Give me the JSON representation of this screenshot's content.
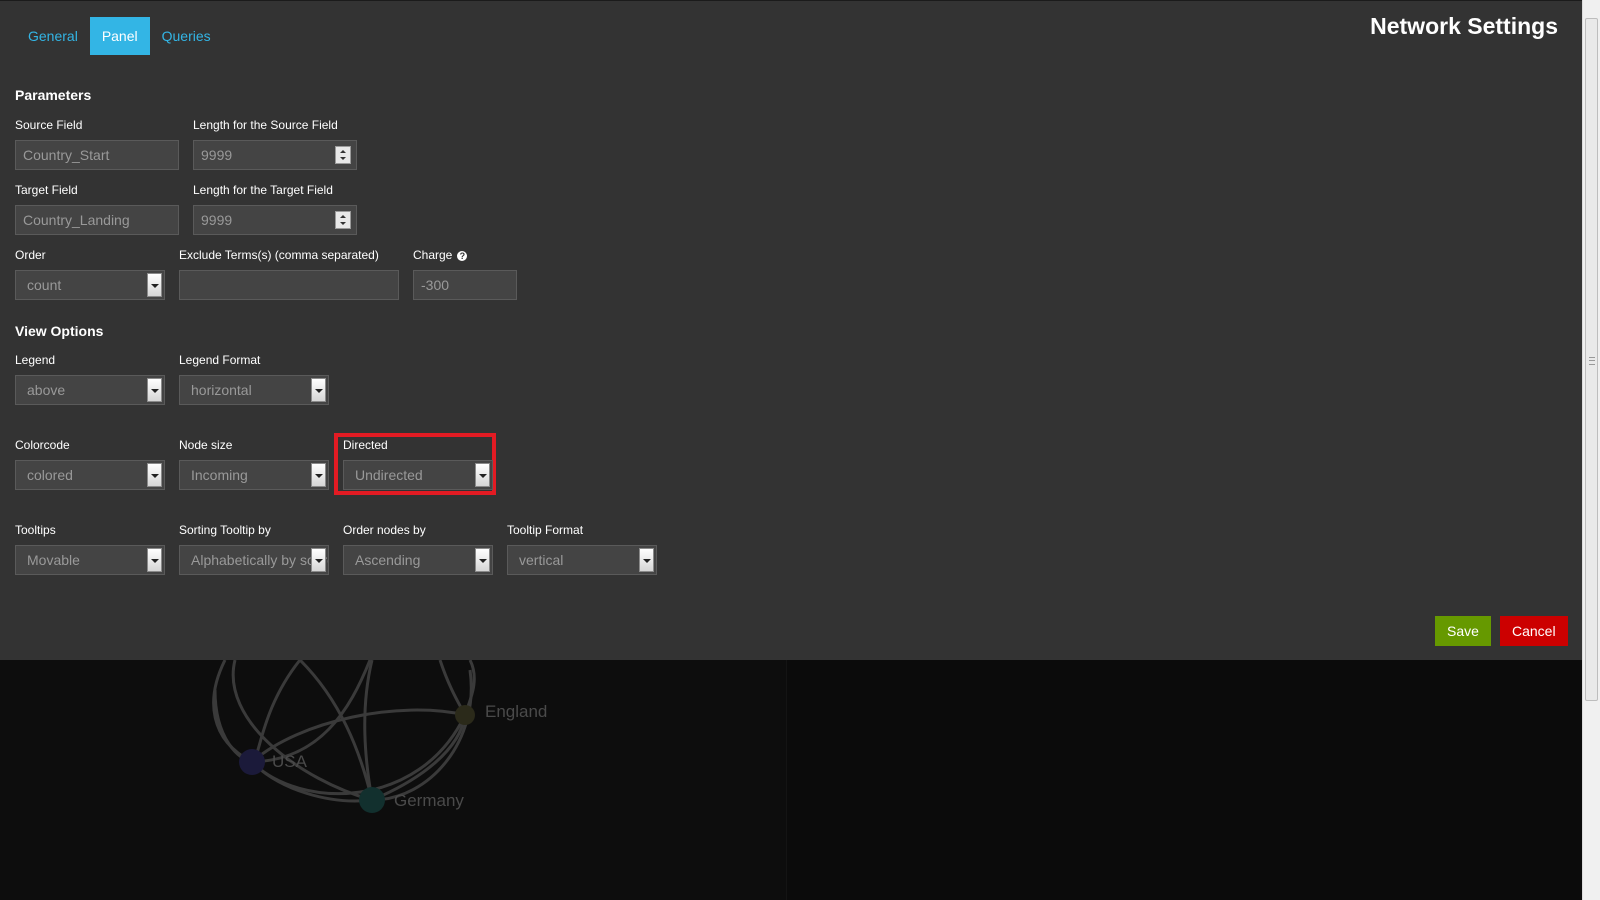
{
  "tabs": [
    {
      "label": "General",
      "active": false
    },
    {
      "label": "Panel",
      "active": true
    },
    {
      "label": "Queries",
      "active": false
    }
  ],
  "title": "Network Settings",
  "parameters": {
    "heading": "Parameters",
    "source_field": {
      "label": "Source Field",
      "value": "Country_Start"
    },
    "source_length": {
      "label": "Length for the Source Field",
      "value": "9999"
    },
    "target_field": {
      "label": "Target Field",
      "value": "Country_Landing"
    },
    "target_length": {
      "label": "Length for the Target Field",
      "value": "9999"
    },
    "order": {
      "label": "Order",
      "value": "count"
    },
    "exclude": {
      "label": "Exclude Terms(s) (comma separated)",
      "value": ""
    },
    "charge": {
      "label": "Charge",
      "value": "-300",
      "help_icon": "question-circle-icon"
    }
  },
  "view_options": {
    "heading": "View Options",
    "legend": {
      "label": "Legend",
      "value": "above"
    },
    "legend_format": {
      "label": "Legend Format",
      "value": "horizontal"
    },
    "colorcode": {
      "label": "Colorcode",
      "value": "colored"
    },
    "node_size": {
      "label": "Node size",
      "value": "Incoming"
    },
    "directed": {
      "label": "Directed",
      "value": "Undirected"
    },
    "tooltips": {
      "label": "Tooltips",
      "value": "Movable"
    },
    "sorting_tooltip": {
      "label": "Sorting Tooltip by",
      "value": "Alphabetically by source"
    },
    "order_nodes": {
      "label": "Order nodes by",
      "value": "Ascending"
    },
    "tooltip_format": {
      "label": "Tooltip Format",
      "value": "vertical"
    }
  },
  "buttons": {
    "save": "Save",
    "cancel": "Cancel"
  },
  "graph_labels": {
    "england": "England",
    "usa": "USA",
    "germany": "Germany"
  },
  "colors": {
    "accent": "#33b5e5",
    "save": "#669900",
    "cancel": "#cc0000",
    "highlight": "#e31b23"
  }
}
